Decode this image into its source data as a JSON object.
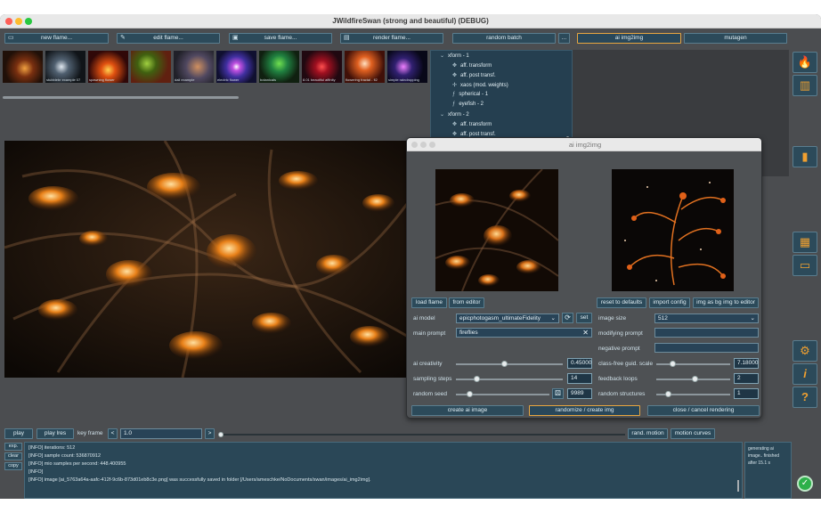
{
  "window": {
    "title": "JWildfireSwan (strong and beautiful) (DEBUG)"
  },
  "toolbar": {
    "new_flame": "new flame...",
    "edit_flame": "edit flame...",
    "save_flame": "save flame...",
    "render_flame": "render flame...",
    "random_batch": "random batch",
    "more": "...",
    "ai_img2img": "ai img2img",
    "mutagen": "mutagen"
  },
  "thumbnails": [
    {
      "label": ""
    },
    {
      "label": "stubblebr example 07"
    },
    {
      "label": "spawning flower"
    },
    {
      "label": ""
    },
    {
      "label": "dali example"
    },
    {
      "label": "electric flower"
    },
    {
      "label": "botanicals"
    },
    {
      "label": "8.01 beautiful affinity"
    },
    {
      "label": "flowering fractal - fl2"
    },
    {
      "label": "simple raindropping"
    }
  ],
  "tree": {
    "items": [
      {
        "label": "xform - 1",
        "kind": "group"
      },
      {
        "label": "aff. transform",
        "kind": "item",
        "icon": "move-icon"
      },
      {
        "label": "aff. post transf.",
        "kind": "item",
        "icon": "move-icon"
      },
      {
        "label": "xaos (mod. weights)",
        "kind": "item",
        "icon": "xaos-icon"
      },
      {
        "label": "spherical - 1",
        "kind": "item",
        "icon": "function-icon"
      },
      {
        "label": "eyefish - 2",
        "kind": "item",
        "icon": "function-icon"
      },
      {
        "label": "xform - 2",
        "kind": "group"
      },
      {
        "label": "aff. transform",
        "kind": "item",
        "icon": "move-icon"
      },
      {
        "label": "aff. post transf.",
        "kind": "item",
        "icon": "move-icon"
      }
    ]
  },
  "dialog": {
    "title": "ai img2img",
    "load_flame": "load flame",
    "from_editor": "from editor",
    "reset_defaults": "reset to defaults",
    "import_config": "import config",
    "img_as_bg": "img as bg img to editor",
    "ai_model_label": "ai model",
    "ai_model_value": "epicphotogasm_ultimateFidelity",
    "set": "set",
    "main_prompt_label": "main prompt",
    "main_prompt_value": "fireflies",
    "image_size_label": "image size",
    "image_size_value": "512",
    "modifying_prompt_label": "modifying prompt",
    "modifying_prompt_value": "",
    "negative_prompt_label": "negative prompt",
    "negative_prompt_value": "",
    "ai_creativity_label": "ai creativity",
    "ai_creativity_value": "0.45000",
    "ai_creativity_level": 0.45,
    "sampling_steps_label": "sampling steps",
    "sampling_steps_value": "14",
    "random_seed_label": "random seed",
    "random_seed_value": "9989",
    "class_free_label": "class-free guid. scale",
    "class_free_value": "7.18000",
    "feedback_loops_label": "feedback loops",
    "feedback_loops_value": "2",
    "random_structures_label": "random structures",
    "random_structures_value": "1",
    "create_ai_image": "create ai image",
    "randomize_create": "randomize / create img",
    "close_cancel": "close / cancel rendering"
  },
  "bottom": {
    "play": "play",
    "play_lres": "play lres",
    "key_frame_label": "key frame",
    "prev": "<",
    "key_frame_value": "1.0",
    "next": ">",
    "rand_motion": "rand. motion",
    "motion_curves": "motion curves"
  },
  "console": {
    "exp": "exp.",
    "clear": "clear",
    "copy": "copy",
    "lines": [
      "[INFO]   iterations: 512",
      "[INFO]   sample count: 536870912",
      "[INFO]   mio samples per second: 448.400955",
      "[INFO]",
      "[INFO]   image [ai_5763a64a-aafc-412f-9c6b-873d01eb8c3e.png] was successfully saved in folder [/Users/ameschke/NoDocuments/swan/images/ai_img2img]."
    ]
  },
  "status": {
    "lines": [
      "generating ai",
      "image.. finished",
      "after 15.1 s"
    ]
  },
  "sidebar": {
    "icons": [
      "flame-icon",
      "grid-icon",
      "player-icon",
      "gallery-icon",
      "folder-icon",
      "gear-icon",
      "info-icon",
      "help-icon"
    ]
  }
}
